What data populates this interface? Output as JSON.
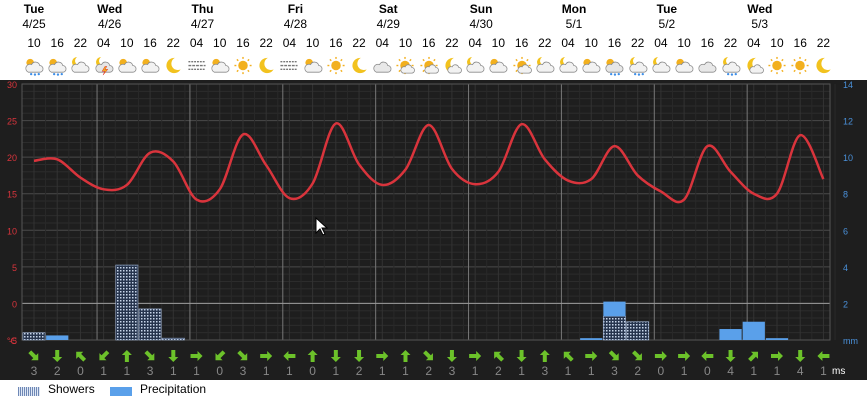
{
  "days": [
    {
      "weekday": "Tue",
      "date": "4/25"
    },
    {
      "weekday": "Wed",
      "date": "4/26"
    },
    {
      "weekday": "Thu",
      "date": "4/27"
    },
    {
      "weekday": "Fri",
      "date": "4/28"
    },
    {
      "weekday": "Sat",
      "date": "4/29"
    },
    {
      "weekday": "Sun",
      "date": "4/30"
    },
    {
      "weekday": "Mon",
      "date": "5/1"
    },
    {
      "weekday": "Tue",
      "date": "5/2"
    },
    {
      "weekday": "Wed",
      "date": "5/3"
    }
  ],
  "slots": [
    {
      "hour": "10",
      "icon": "partly-cloudy-drizzle-icon",
      "wind_dir": "SE",
      "wind": "3"
    },
    {
      "hour": "16",
      "icon": "partly-cloudy-drizzle-icon",
      "wind_dir": "S",
      "wind": "2"
    },
    {
      "hour": "22",
      "icon": "cloudy-night-icon",
      "wind_dir": "NW",
      "wind": "0"
    },
    {
      "hour": "04",
      "icon": "thunder-shower-night-icon",
      "wind_dir": "SW",
      "wind": "1"
    },
    {
      "hour": "10",
      "icon": "partly-cloudy-icon",
      "wind_dir": "N",
      "wind": "1"
    },
    {
      "hour": "16",
      "icon": "partly-cloudy-icon",
      "wind_dir": "SE",
      "wind": "3"
    },
    {
      "hour": "22",
      "icon": "moon-icon",
      "wind_dir": "S",
      "wind": "1"
    },
    {
      "hour": "04",
      "icon": "fog-icon",
      "wind_dir": "E",
      "wind": "1"
    },
    {
      "hour": "10",
      "icon": "partly-cloudy-icon",
      "wind_dir": "SW",
      "wind": "0"
    },
    {
      "hour": "16",
      "icon": "sun-icon",
      "wind_dir": "SE",
      "wind": "3"
    },
    {
      "hour": "22",
      "icon": "moon-icon",
      "wind_dir": "E",
      "wind": "1"
    },
    {
      "hour": "04",
      "icon": "fog-icon",
      "wind_dir": "W",
      "wind": "1"
    },
    {
      "hour": "10",
      "icon": "partly-cloudy-icon",
      "wind_dir": "N",
      "wind": "0"
    },
    {
      "hour": "16",
      "icon": "sun-icon",
      "wind_dir": "S",
      "wind": "1"
    },
    {
      "hour": "22",
      "icon": "moon-icon",
      "wind_dir": "S",
      "wind": "2"
    },
    {
      "hour": "04",
      "icon": "cloud-icon",
      "wind_dir": "E",
      "wind": "1"
    },
    {
      "hour": "10",
      "icon": "sun-cloud-icon",
      "wind_dir": "N",
      "wind": "1"
    },
    {
      "hour": "16",
      "icon": "sun-cloud-icon",
      "wind_dir": "SE",
      "wind": "2"
    },
    {
      "hour": "22",
      "icon": "moon-cloud-icon",
      "wind_dir": "S",
      "wind": "3"
    },
    {
      "hour": "04",
      "icon": "cloudy-night-icon",
      "wind_dir": "E",
      "wind": "1"
    },
    {
      "hour": "10",
      "icon": "partly-cloudy-icon",
      "wind_dir": "NW",
      "wind": "2"
    },
    {
      "hour": "16",
      "icon": "sun-cloud-icon",
      "wind_dir": "S",
      "wind": "1"
    },
    {
      "hour": "22",
      "icon": "cloudy-night-icon",
      "wind_dir": "N",
      "wind": "3"
    },
    {
      "hour": "04",
      "icon": "cloudy-night-icon",
      "wind_dir": "NW",
      "wind": "1"
    },
    {
      "hour": "10",
      "icon": "partly-cloudy-icon",
      "wind_dir": "E",
      "wind": "1"
    },
    {
      "hour": "16",
      "icon": "partly-cloudy-rain-icon",
      "wind_dir": "SE",
      "wind": "3"
    },
    {
      "hour": "22",
      "icon": "shower-night-icon",
      "wind_dir": "SE",
      "wind": "2"
    },
    {
      "hour": "04",
      "icon": "cloudy-night-icon",
      "wind_dir": "E",
      "wind": "0"
    },
    {
      "hour": "10",
      "icon": "partly-cloudy-icon",
      "wind_dir": "E",
      "wind": "1"
    },
    {
      "hour": "16",
      "icon": "cloud-icon",
      "wind_dir": "W",
      "wind": "0"
    },
    {
      "hour": "22",
      "icon": "shower-night-icon",
      "wind_dir": "S",
      "wind": "4"
    },
    {
      "hour": "04",
      "icon": "moon-cloud-icon",
      "wind_dir": "NE",
      "wind": "1"
    },
    {
      "hour": "10",
      "icon": "sun-icon",
      "wind_dir": "E",
      "wind": "1"
    },
    {
      "hour": "16",
      "icon": "sun-icon",
      "wind_dir": "S",
      "wind": "4"
    },
    {
      "hour": "22",
      "icon": "moon-icon",
      "wind_dir": "W",
      "wind": "1"
    }
  ],
  "left_axis": {
    "ticks": [
      "30",
      "25",
      "20",
      "15",
      "10",
      "5",
      "0",
      "-5"
    ],
    "unit": "°C"
  },
  "right_axis": {
    "ticks": [
      "14",
      "12",
      "10",
      "8",
      "6",
      "4",
      "2"
    ],
    "unit": "mm"
  },
  "wind_unit": "ms",
  "legend": {
    "showers": "Showers",
    "precipitation": "Precipitation"
  },
  "colors": {
    "temperature": "#d9343c",
    "background": "#222222",
    "grid": "#444444",
    "showers": "#b8c7dc",
    "precipitation": "#5aa0ea",
    "wind_arrow": "#6cc22a",
    "left_axis": "#d9343c",
    "right_axis": "#4a90d9"
  },
  "chart_data": {
    "type": "line",
    "x": [
      0,
      1,
      2,
      3,
      4,
      5,
      6,
      7,
      8,
      9,
      10,
      11,
      12,
      13,
      14,
      15,
      16,
      17,
      18,
      19,
      20,
      21,
      22,
      23,
      24,
      25,
      26,
      27,
      28,
      29,
      30,
      31,
      32,
      33,
      34
    ],
    "series": [
      {
        "axis": "left",
        "values": [
          19.5,
          19.7,
          17.2,
          15.6,
          16.2,
          20.6,
          19.4,
          14.2,
          15.6,
          23.1,
          18.9,
          14.4,
          16.4,
          24.6,
          19.0,
          16.2,
          18.3,
          24.4,
          18.4,
          16.3,
          18.0,
          24.5,
          19.7,
          16.8,
          17.0,
          21.5,
          17.5,
          15.3,
          14.2,
          21.5,
          18.0,
          15.0,
          15.0,
          23.0,
          17.0
        ]
      },
      {
        "name": "Showers",
        "type": "bar",
        "axis": "right",
        "values": [
          0.4,
          0.0,
          0.0,
          0.0,
          4.1,
          1.7,
          0.1,
          0.0,
          0.0,
          0.0,
          0.0,
          0.0,
          0.0,
          0.0,
          0.0,
          0.0,
          0.0,
          0.0,
          0.0,
          0.0,
          0.0,
          0.0,
          0.0,
          0.0,
          0.0,
          1.3,
          1.0,
          0.0,
          0.0,
          0.0,
          0.0,
          0.0,
          0.0,
          0.0,
          0.0
        ]
      },
      {
        "name": "Precipitation",
        "type": "bar",
        "axis": "right",
        "values": [
          0.0,
          0.25,
          0.0,
          0.0,
          0.0,
          0.0,
          0.0,
          0.0,
          0.0,
          0.0,
          0.0,
          0.0,
          0.0,
          0.0,
          0.0,
          0.0,
          0.0,
          0.0,
          0.0,
          0.0,
          0.0,
          0.0,
          0.0,
          0.0,
          0.1,
          0.8,
          0.0,
          0.0,
          0.0,
          0.0,
          0.6,
          1.0,
          0.1,
          0.0,
          0.0
        ]
      }
    ],
    "ylim_left": [
      -5,
      30
    ],
    "ylim_right": [
      0,
      14
    ],
    "grid": true,
    "legend_placement": "bottom-left"
  }
}
